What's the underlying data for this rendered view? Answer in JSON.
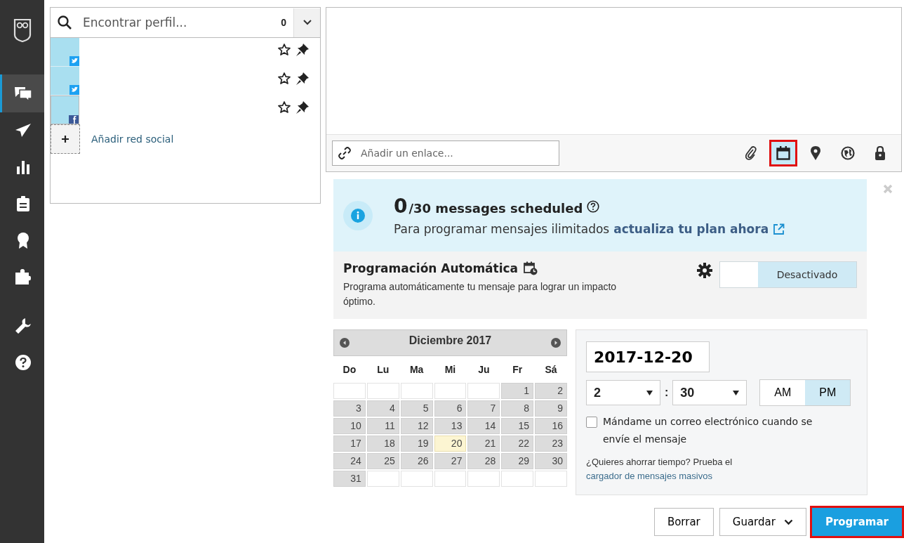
{
  "nav": {
    "items": [
      {
        "kind": "logo",
        "selected": false
      },
      {
        "kind": "streams",
        "selected": true
      },
      {
        "kind": "publish",
        "selected": false
      },
      {
        "kind": "analytics",
        "selected": false
      },
      {
        "kind": "assignments",
        "selected": false
      },
      {
        "kind": "award",
        "selected": false
      },
      {
        "kind": "apps",
        "selected": false
      },
      {
        "kind": "tools",
        "selected": false
      },
      {
        "kind": "help",
        "selected": false
      }
    ]
  },
  "profile_picker": {
    "search": {
      "placeholder": "Encontrar perfil..."
    },
    "count": "0",
    "profiles": [
      {
        "kind": "twitter"
      },
      {
        "kind": "twitter"
      },
      {
        "kind": "facebook"
      }
    ],
    "add_label": "Añadir red social"
  },
  "composer": {
    "link": {
      "placeholder": "Añadir un enlace..."
    },
    "tools": [
      {
        "kind": "attach",
        "selected": false,
        "highlighted": false
      },
      {
        "kind": "calendar",
        "selected": true,
        "highlighted": true
      },
      {
        "kind": "location",
        "selected": false,
        "highlighted": false
      },
      {
        "kind": "globe",
        "selected": false,
        "highlighted": false
      },
      {
        "kind": "lock",
        "selected": false,
        "highlighted": false
      }
    ]
  },
  "notice": {
    "count": "0",
    "total": "/30 messages scheduled",
    "text": "Para programar mensajes ilimitados",
    "link": "actualiza tu plan ahora"
  },
  "auto_schedule": {
    "title": "Programación Automática",
    "description": "Programa automáticamente tu mensaje para lograr un impacto óptimo.",
    "toggle": {
      "label": "Desactivado",
      "on": false
    }
  },
  "calendar": {
    "month": "Diciembre 2017",
    "weekdays": [
      "Do",
      "Lu",
      "Ma",
      "Mi",
      "Ju",
      "Fr",
      "Sá"
    ],
    "weeks": [
      [
        {
          "kind": "blank"
        },
        {
          "kind": "blank"
        },
        {
          "kind": "blank"
        },
        {
          "kind": "blank"
        },
        {
          "kind": "blank"
        },
        {
          "kind": "day",
          "day": "1",
          "selected": false
        },
        {
          "kind": "day",
          "day": "2",
          "selected": false
        }
      ],
      [
        {
          "kind": "day",
          "day": "3",
          "selected": false
        },
        {
          "kind": "day",
          "day": "4",
          "selected": false
        },
        {
          "kind": "day",
          "day": "5",
          "selected": false
        },
        {
          "kind": "day",
          "day": "6",
          "selected": false
        },
        {
          "kind": "day",
          "day": "7",
          "selected": false
        },
        {
          "kind": "day",
          "day": "8",
          "selected": false
        },
        {
          "kind": "day",
          "day": "9",
          "selected": false
        }
      ],
      [
        {
          "kind": "day",
          "day": "10",
          "selected": false
        },
        {
          "kind": "day",
          "day": "11",
          "selected": false
        },
        {
          "kind": "day",
          "day": "12",
          "selected": false
        },
        {
          "kind": "day",
          "day": "13",
          "selected": false
        },
        {
          "kind": "day",
          "day": "14",
          "selected": false
        },
        {
          "kind": "day",
          "day": "15",
          "selected": false
        },
        {
          "kind": "day",
          "day": "16",
          "selected": false
        }
      ],
      [
        {
          "kind": "day",
          "day": "17",
          "selected": false
        },
        {
          "kind": "day",
          "day": "18",
          "selected": false
        },
        {
          "kind": "day",
          "day": "19",
          "selected": false
        },
        {
          "kind": "day",
          "day": "20",
          "selected": true
        },
        {
          "kind": "day",
          "day": "21",
          "selected": false
        },
        {
          "kind": "day",
          "day": "22",
          "selected": false
        },
        {
          "kind": "day",
          "day": "23",
          "selected": false
        }
      ],
      [
        {
          "kind": "day",
          "day": "24",
          "selected": false
        },
        {
          "kind": "day",
          "day": "25",
          "selected": false
        },
        {
          "kind": "day",
          "day": "26",
          "selected": false
        },
        {
          "kind": "day",
          "day": "27",
          "selected": false
        },
        {
          "kind": "day",
          "day": "28",
          "selected": false
        },
        {
          "kind": "day",
          "day": "29",
          "selected": false
        },
        {
          "kind": "day",
          "day": "30",
          "selected": false
        }
      ],
      [
        {
          "kind": "day",
          "day": "31",
          "selected": false
        },
        {
          "kind": "blank"
        },
        {
          "kind": "blank"
        },
        {
          "kind": "blank"
        },
        {
          "kind": "blank"
        },
        {
          "kind": "blank"
        },
        {
          "kind": "blank"
        }
      ]
    ]
  },
  "time": {
    "date": "2017-12-20",
    "hour": "2",
    "separator": ":",
    "minute": "30",
    "meridiem": [
      {
        "label": "AM",
        "selected": false
      },
      {
        "label": "PM",
        "selected": true
      }
    ],
    "email": {
      "label": "Mándame un correo electrónico cuando se envíe el mensaje",
      "checked": false
    },
    "hint": "¿Quieres ahorrar tiempo? Prueba el",
    "hint_link": "cargador de mensajes masivos"
  },
  "buttons": [
    {
      "kind": "plain",
      "label": "Borrar",
      "highlighted": false
    },
    {
      "kind": "dropdown",
      "label": "Guardar",
      "highlighted": false
    },
    {
      "kind": "primary",
      "label": "Programar",
      "highlighted": true
    }
  ]
}
